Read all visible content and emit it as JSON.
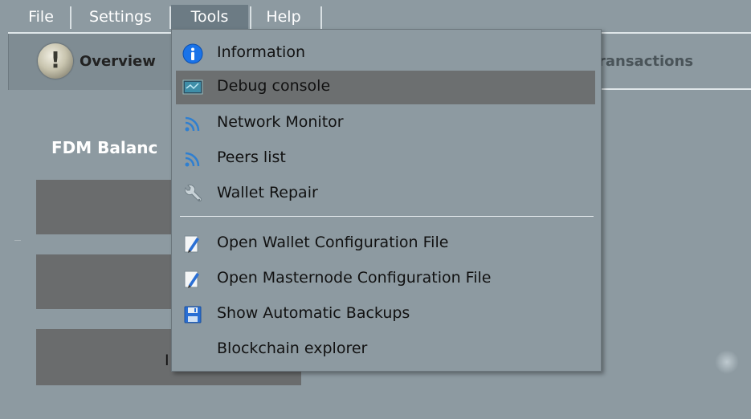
{
  "menubar": {
    "items": [
      {
        "label": "File"
      },
      {
        "label": "Settings"
      },
      {
        "label": "Tools"
      },
      {
        "label": "Help"
      }
    ]
  },
  "toolbar": {
    "overview_label": "Overview",
    "transactions_label": "ransactions"
  },
  "main": {
    "balance_title": "FDM Balanc",
    "partial_digit": "I"
  },
  "tools_menu": {
    "items": [
      {
        "label": "Information",
        "icon": "info-icon"
      },
      {
        "label": "Debug console",
        "icon": "console-icon"
      },
      {
        "label": "Network Monitor",
        "icon": "network-icon"
      },
      {
        "label": "Peers list",
        "icon": "network-icon"
      },
      {
        "label": "Wallet Repair",
        "icon": "wrench-icon"
      },
      {
        "label": "Open Wallet Configuration File",
        "icon": "edit-file-icon"
      },
      {
        "label": "Open Masternode Configuration File",
        "icon": "edit-file-icon"
      },
      {
        "label": "Show Automatic Backups",
        "icon": "floppy-disk-icon"
      },
      {
        "label": "Blockchain explorer",
        "icon": ""
      }
    ]
  },
  "colors": {
    "background": "#8d9aa1",
    "hover": "#6c6f70",
    "balance_box": "#6a6c6d",
    "active_menu": "#6c7b84"
  }
}
